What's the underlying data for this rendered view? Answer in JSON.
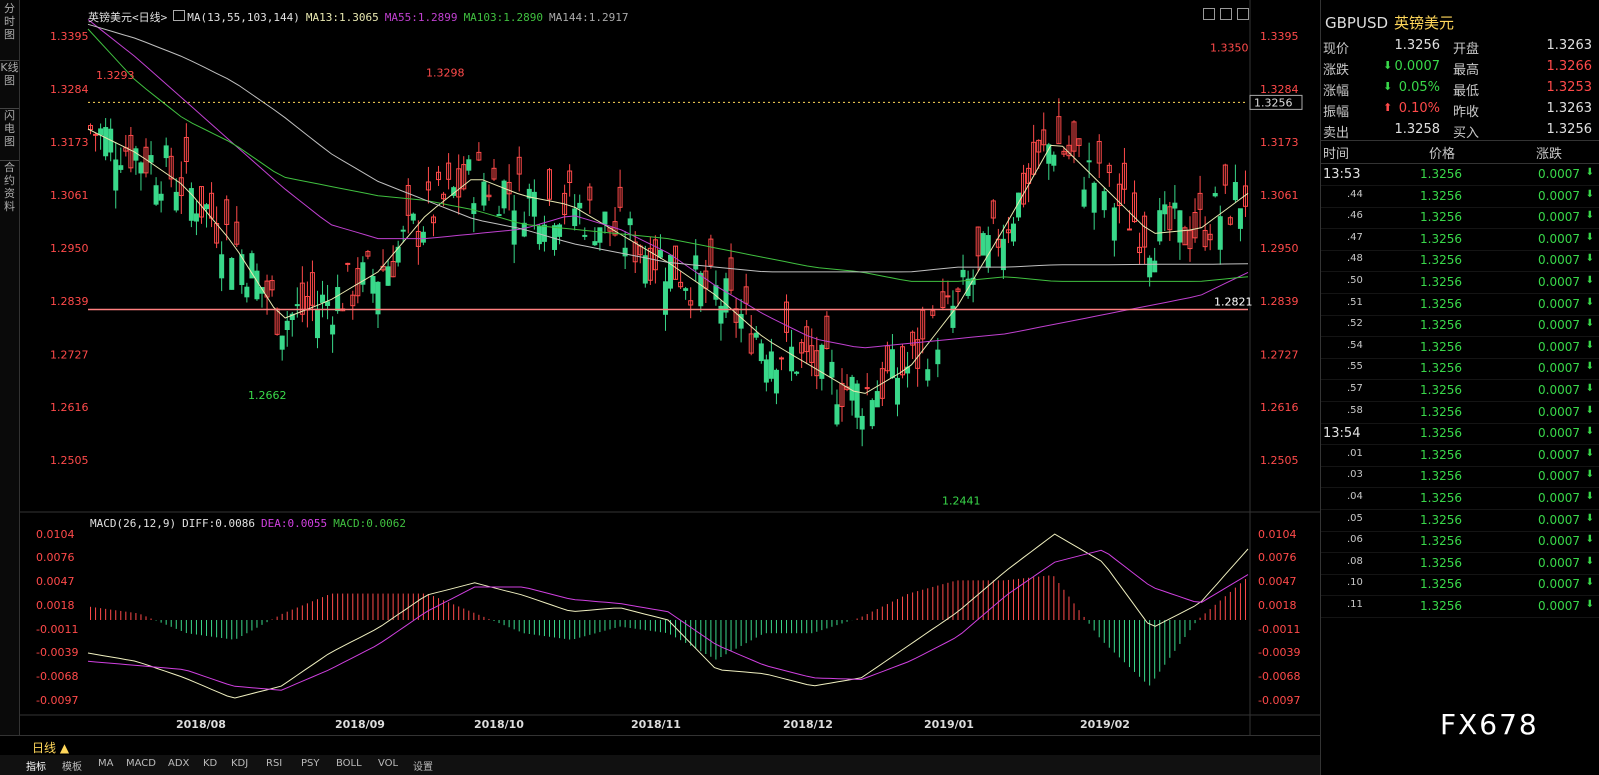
{
  "left_tabs": [
    "分时图",
    "K线图",
    "闪电图",
    "合约资料"
  ],
  "legend_main": {
    "ma_label": "英镑美元<日线>",
    "ma_params": "MA(13,55,103,144)",
    "ma13": "MA13:1.3065",
    "ma55": "MA55:1.2899",
    "ma103": "MA103:1.2890",
    "ma144": "MA144:1.2917"
  },
  "legend_macd": {
    "params": "MACD(26,12,9)",
    "diff": "DIFF:0.0086",
    "dea": "DEA:0.0055",
    "macd": "MACD:0.0062"
  },
  "colors": {
    "up": "#ff4a4a",
    "down": "#39d88a",
    "ma13": "#e8e8b0",
    "ma55": "#c040d0",
    "ma103": "#40c040",
    "ma144": "#c0c0c0",
    "diff": "#f0f0c0",
    "dea": "#d040e0",
    "support": "#ff8080"
  },
  "price_axis": {
    "ticks": [
      "1.3395",
      "1.3284",
      "1.3173",
      "1.3061",
      "1.2950",
      "1.2839",
      "1.2727",
      "1.2616",
      "1.2505"
    ],
    "current": "1.3256",
    "support": "1.2821"
  },
  "macd_axis": {
    "ticks": [
      "0.0104",
      "0.0076",
      "0.0047",
      "0.0018",
      "-0.0011",
      "-0.0039",
      "-0.0068",
      "-0.0097"
    ]
  },
  "annotations": {
    "high_left": "1.3293",
    "high_sep": "1.3298",
    "low_aug": "1.2662",
    "low_jan": "1.2441",
    "high_feb": "1.3350"
  },
  "x_labels": [
    "2018/08",
    "2018/09",
    "2018/10",
    "2018/11",
    "2018/12",
    "2019/01",
    "2019/02"
  ],
  "period_label": "日线 ▲",
  "bottom_tabs": [
    "指标",
    "模板",
    "MA",
    "MACD",
    "ADX",
    "KD",
    "KDJ",
    "RSI",
    "PSY",
    "BOLL",
    "VOL",
    "设置"
  ],
  "quote": {
    "symbol": "GBPUSD",
    "name": "英镑美元",
    "rows": [
      {
        "l1": "现价",
        "v1": "1.3256",
        "l2": "开盘",
        "v2": "1.3263"
      },
      {
        "l1": "涨跌",
        "v1": "0.0007",
        "l2": "最高",
        "v2": "1.3266"
      },
      {
        "l1": "涨幅",
        "v1": "0.05%",
        "l2": "最低",
        "v2": "1.3253"
      },
      {
        "l1": "振幅",
        "v1": "0.10%",
        "l2": "昨收",
        "v2": "1.3263"
      },
      {
        "l1": "卖出",
        "v1": "1.3258",
        "l2": "买入",
        "v2": "1.3256"
      }
    ],
    "arrow_down": "⬇",
    "arrow_up": "⬆",
    "ticks_header": {
      "time": "时间",
      "price": "价格",
      "change": "涨跌"
    },
    "ticks": [
      {
        "t": "13:53",
        "p": "1.3256",
        "c": "0.0007"
      },
      {
        "t": ".44",
        "p": "1.3256",
        "c": "0.0007"
      },
      {
        "t": ".46",
        "p": "1.3256",
        "c": "0.0007"
      },
      {
        "t": ".47",
        "p": "1.3256",
        "c": "0.0007"
      },
      {
        "t": ".48",
        "p": "1.3256",
        "c": "0.0007"
      },
      {
        "t": ".50",
        "p": "1.3256",
        "c": "0.0007"
      },
      {
        "t": ".51",
        "p": "1.3256",
        "c": "0.0007"
      },
      {
        "t": ".52",
        "p": "1.3256",
        "c": "0.0007"
      },
      {
        "t": ".54",
        "p": "1.3256",
        "c": "0.0007"
      },
      {
        "t": ".55",
        "p": "1.3256",
        "c": "0.0007"
      },
      {
        "t": ".57",
        "p": "1.3256",
        "c": "0.0007"
      },
      {
        "t": ".58",
        "p": "1.3256",
        "c": "0.0007"
      },
      {
        "t": "13:54",
        "p": "1.3256",
        "c": "0.0007"
      },
      {
        "t": ".01",
        "p": "1.3256",
        "c": "0.0007"
      },
      {
        "t": ".03",
        "p": "1.3256",
        "c": "0.0007"
      },
      {
        "t": ".04",
        "p": "1.3256",
        "c": "0.0007"
      },
      {
        "t": ".05",
        "p": "1.3256",
        "c": "0.0007"
      },
      {
        "t": ".06",
        "p": "1.3256",
        "c": "0.0007"
      },
      {
        "t": ".08",
        "p": "1.3256",
        "c": "0.0007"
      },
      {
        "t": ".10",
        "p": "1.3256",
        "c": "0.0007"
      },
      {
        "t": ".11",
        "p": "1.3256",
        "c": "0.0007"
      }
    ]
  },
  "watermark": "FX678",
  "chart_data": {
    "type": "line",
    "title": "英镑美元<日线>",
    "series": [
      {
        "name": "MA13",
        "values": [
          1.32,
          1.315,
          1.308,
          1.296,
          1.28,
          1.284,
          1.29,
          1.302,
          1.31,
          1.306,
          1.304,
          1.298,
          1.292,
          1.285,
          1.276,
          1.27,
          1.264,
          1.27,
          1.283,
          1.3,
          1.318,
          1.308,
          1.298,
          1.299,
          1.3065
        ]
      },
      {
        "name": "MA55",
        "values": [
          1.343,
          1.335,
          1.326,
          1.317,
          1.308,
          1.3,
          1.297,
          1.297,
          1.298,
          1.299,
          1.302,
          1.299,
          1.294,
          1.287,
          1.281,
          1.276,
          1.274,
          1.275,
          1.276,
          1.277,
          1.279,
          1.281,
          1.283,
          1.285,
          1.2899
        ]
      },
      {
        "name": "MA103",
        "values": [
          1.341,
          1.33,
          1.322,
          1.317,
          1.31,
          1.308,
          1.306,
          1.305,
          1.303,
          1.3,
          1.299,
          1.298,
          1.297,
          1.295,
          1.293,
          1.291,
          1.29,
          1.288,
          1.288,
          1.289,
          1.288,
          1.288,
          1.288,
          1.288,
          1.289
        ]
      },
      {
        "name": "MA144",
        "values": [
          1.342,
          1.339,
          1.335,
          1.33,
          1.323,
          1.315,
          1.309,
          1.305,
          1.301,
          1.299,
          1.296,
          1.294,
          1.292,
          1.291,
          1.29,
          1.29,
          1.29,
          1.29,
          1.291,
          1.291,
          1.2915,
          1.2915,
          1.2916,
          1.2916,
          1.2917
        ]
      }
    ],
    "macd": {
      "diff": [
        -0.004,
        -0.005,
        -0.007,
        -0.0095,
        -0.008,
        -0.004,
        -0.001,
        0.003,
        0.0045,
        0.003,
        0.001,
        0.0015,
        0.0,
        -0.006,
        -0.0065,
        -0.008,
        -0.007,
        -0.003,
        0.001,
        0.006,
        0.0104,
        0.007,
        -0.001,
        0.002,
        0.0086
      ],
      "dea": [
        -0.005,
        -0.0055,
        -0.006,
        -0.008,
        -0.0085,
        -0.006,
        -0.003,
        0.001,
        0.004,
        0.004,
        0.0025,
        0.002,
        0.001,
        -0.003,
        -0.0055,
        -0.007,
        -0.0072,
        -0.005,
        -0.002,
        0.003,
        0.007,
        0.0085,
        0.004,
        0.002,
        0.0055
      ]
    },
    "ylim": [
      1.2441,
      1.3395
    ],
    "support_level": 1.2821
  }
}
